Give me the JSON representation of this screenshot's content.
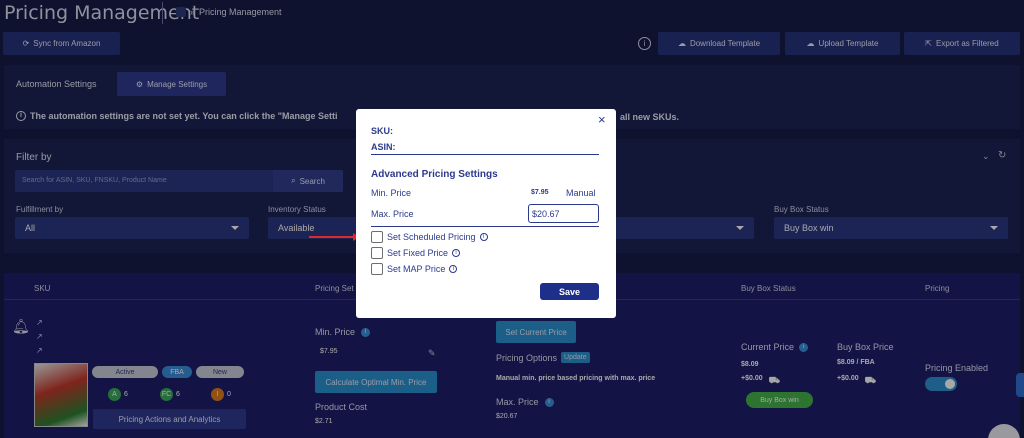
{
  "header": {
    "title": "Pricing Management",
    "breadcrumb": "Pricing Management",
    "breadcrumb_sep": "»"
  },
  "toolbar": {
    "sync": "Sync from Amazon",
    "download": "Download Template",
    "upload": "Upload Template",
    "export": "Export as Filtered"
  },
  "automation": {
    "label": "Automation Settings",
    "manage": "Manage Settings",
    "notice_left": "The automation settings are not set yet. You can click the \"Manage Setti",
    "notice_right": "all new SKUs."
  },
  "filter": {
    "title": "Filter by",
    "search_placeholder": "Search for ASIN, SKU, FNSKU, Product Name",
    "search_btn": "Search",
    "fulfillment_label": "Fulfillment by",
    "fulfillment_value": "All",
    "inventory_label": "Inventory Status",
    "inventory_value": "Available",
    "buybox_label": "Buy Box Status",
    "buybox_value": "Buy Box win"
  },
  "table": {
    "col_sku": "SKU",
    "col_pricing_settings": "Pricing Set",
    "col_buybox": "Buy Box Status",
    "col_pricing": "Pricing"
  },
  "row": {
    "badges": [
      "Active",
      "FBA",
      "New"
    ],
    "counts": [
      {
        "letter": "A",
        "value": "6",
        "color": "#3aa85a"
      },
      {
        "letter": "FC",
        "value": "6",
        "color": "#3aa85a"
      },
      {
        "letter": "I",
        "value": "0",
        "color": "#e07a20"
      }
    ],
    "actions": "Pricing Actions and Analytics",
    "min_price_label": "Min. Price",
    "min_price": "$7.95",
    "calc_btn": "Calculate Optimal Min. Price",
    "product_cost_label": "Product Cost",
    "product_cost": "$2.71",
    "set_current_btn": "Set Current Price",
    "pricing_options": "Pricing Options",
    "update_badge": "Update",
    "manual_text": "Manual min. price based pricing with max. price",
    "max_price_label": "Max. Price",
    "max_price": "$20.67",
    "current_price_label": "Current Price",
    "current_price": "$8.09",
    "current_ship": "+$0.00",
    "buybox_price_label": "Buy Box Price",
    "buybox_price": "$8.09 / FBA",
    "buybox_ship": "+$0.00",
    "buybox_win": "Buy Box win",
    "pricing_enabled": "Pricing Enabled"
  },
  "modal": {
    "sku_label": "SKU:",
    "asin_label": "ASIN:",
    "section_title": "Advanced Pricing Settings",
    "min_price_label": "Min. Price",
    "min_price_value": "$7.95",
    "min_price_mode": "Manual",
    "max_price_label": "Max. Price",
    "max_price_value": "$20.67",
    "options": [
      "Set Scheduled Pricing",
      "Set Fixed Price",
      "Set MAP Price"
    ],
    "save": "Save",
    "close": "×"
  },
  "colors": {
    "background": "#161c48",
    "panel": "#1c2456",
    "accent": "#27327a",
    "modal_text": "#2b3a8c",
    "arrow": "#e02828",
    "toggle": "#2f8fd0"
  }
}
